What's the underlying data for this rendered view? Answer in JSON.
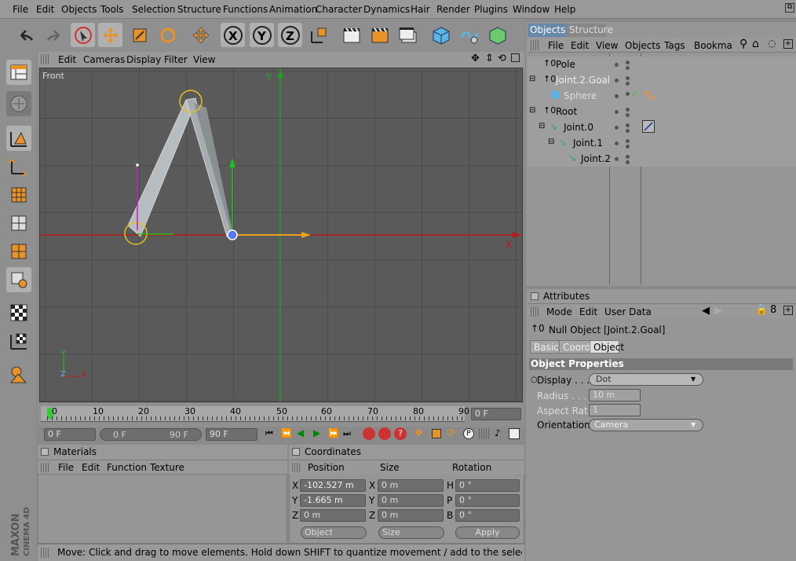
{
  "menu": [
    "File",
    "Edit",
    "Objects",
    "Tools",
    "Selection",
    "Structure",
    "Functions",
    "Animation",
    "Character",
    "Dynamics",
    "Hair",
    "Render",
    "Plugins",
    "Window",
    "Help"
  ],
  "viewport": {
    "menu": [
      "Edit",
      "Cameras",
      "Display",
      "Filter",
      "View"
    ],
    "camera_label": "Front",
    "axis_y": "Y",
    "axis_x": "X",
    "gizmo_y": "Y",
    "gizmo_z": "Z",
    "gizmo_x": "X"
  },
  "timeline": {
    "ticks": [
      "0",
      "10",
      "20",
      "30",
      "40",
      "50",
      "60",
      "70",
      "80",
      "90"
    ],
    "current_frame": "0 F",
    "start": "0 F",
    "range_start": "0 F",
    "range_end": "90 F",
    "end": "90 F"
  },
  "materials": {
    "title": "Materials",
    "menu": [
      "File",
      "Edit",
      "Function",
      "Texture"
    ]
  },
  "coordinates": {
    "title": "Coordinates",
    "headers": [
      "Position",
      "Size",
      "Rotation"
    ],
    "rows": [
      {
        "pl": "X",
        "pv": "-102.527 m",
        "sl": "X",
        "sv": "0 m",
        "rl": "H",
        "rv": "0 °"
      },
      {
        "pl": "Y",
        "pv": "-1.665 m",
        "sl": "Y",
        "sv": "0 m",
        "rl": "P",
        "rv": "0 °"
      },
      {
        "pl": "Z",
        "pv": "0 m",
        "sl": "Z",
        "sv": "0 m",
        "rl": "B",
        "rv": "0 °"
      }
    ],
    "mode1": "Object",
    "mode2": "Size",
    "apply": "Apply"
  },
  "objects_panel": {
    "tabs": [
      "Objects",
      "Structure"
    ],
    "menu": [
      "File",
      "Edit",
      "View",
      "Objects",
      "Tags",
      "Bookma"
    ],
    "tree": [
      "Pole",
      "Joint.2.Goal",
      "Sphere",
      "Root",
      "Joint.0",
      "Joint.1",
      "Joint.2"
    ]
  },
  "attributes": {
    "title": "Attributes",
    "menu": [
      "Mode",
      "Edit",
      "User Data"
    ],
    "object_name": "Null Object [Joint.2.Goal]",
    "tabs": [
      "Basic",
      "Coord.",
      "Object"
    ],
    "section": "Object Properties",
    "display_label": "Display . . . .",
    "display_value": "Dot",
    "radius_label": "Radius . . . .",
    "radius_value": "10 m",
    "aspect_label": "Aspect Ratio",
    "aspect_value": "1",
    "orientation_label": "Orientation",
    "orientation_value": "Camera"
  },
  "status": "Move: Click and drag to move elements. Hold down SHIFT to quantize movement / add to the selection in point mode, CTRL t",
  "logo": "MAXON CINEMA 4D"
}
